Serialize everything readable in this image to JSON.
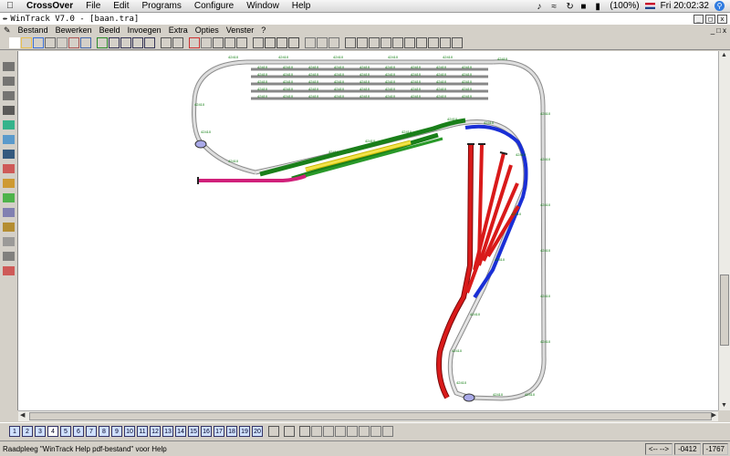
{
  "mac_menubar": {
    "app_name": "CrossOver",
    "items": [
      "File",
      "Edit",
      "Programs",
      "Configure",
      "Window",
      "Help"
    ],
    "battery": "(100%)",
    "clock": "Fri 20:02:32"
  },
  "window": {
    "title": "WinTrack  V7.0 - [baan.tra]"
  },
  "app_menu": {
    "items": [
      "Bestand",
      "Bewerken",
      "Beeld",
      "Invoegen",
      "Extra",
      "Opties",
      "Venster",
      "?"
    ]
  },
  "toolbar": {
    "icons": [
      "new-icon",
      "open-icon",
      "save-icon",
      "print-icon",
      "print-preview-icon",
      "copy-page-icon",
      "help-icon",
      "picture-icon",
      "zoom-out-icon",
      "zoom-in-icon",
      "zoom-window-icon",
      "zoom-fit-icon",
      "undo-icon",
      "redo-icon",
      "delete-icon",
      "lift-icon",
      "cut-icon",
      "copy-icon",
      "paste-icon",
      "snap-icon",
      "turnout-icon",
      "curve-icon",
      "flex-icon",
      "block-1-icon",
      "block-2-icon",
      "block-3-icon",
      "measure-icon",
      "ruler-icon",
      "align-1-icon",
      "align-2-icon",
      "align-3-icon",
      "align-4-icon",
      "align-5-icon",
      "align-6-icon",
      "align-7-icon",
      "context-help-icon"
    ]
  },
  "left_toolbox": {
    "icons": [
      "flex-track-icon",
      "flex-track-2-icon",
      "flex-track-3-icon",
      "bridge-icon",
      "scenery-icon",
      "platform-icon",
      "text-icon",
      "signal-icon",
      "house-icon",
      "tree-icon",
      "station-icon",
      "terrain-icon",
      "level-icon",
      "measure-icon",
      "paint-icon"
    ]
  },
  "layers": {
    "buttons": [
      "1",
      "2",
      "3",
      "4",
      "5",
      "6",
      "7",
      "8",
      "9",
      "10",
      "11",
      "12",
      "13",
      "14",
      "15",
      "16",
      "17",
      "18",
      "19",
      "20"
    ],
    "active": "4"
  },
  "status": {
    "message": "Raadpleeg \"WinTrack Help pdf-bestand\" voor Help",
    "nav": "<-- -->",
    "x": "-0412",
    "y": "-1767"
  },
  "colors": {
    "track_gray": "#b7b7b7",
    "track_green": "#1a7f1a",
    "track_yellow": "#f2e34a",
    "track_red": "#d91a1a",
    "track_blue": "#1a2fd6",
    "track_pink": "#d0207a",
    "label_green": "#0a7a0a"
  },
  "drawing": {
    "track_label": "42410"
  }
}
